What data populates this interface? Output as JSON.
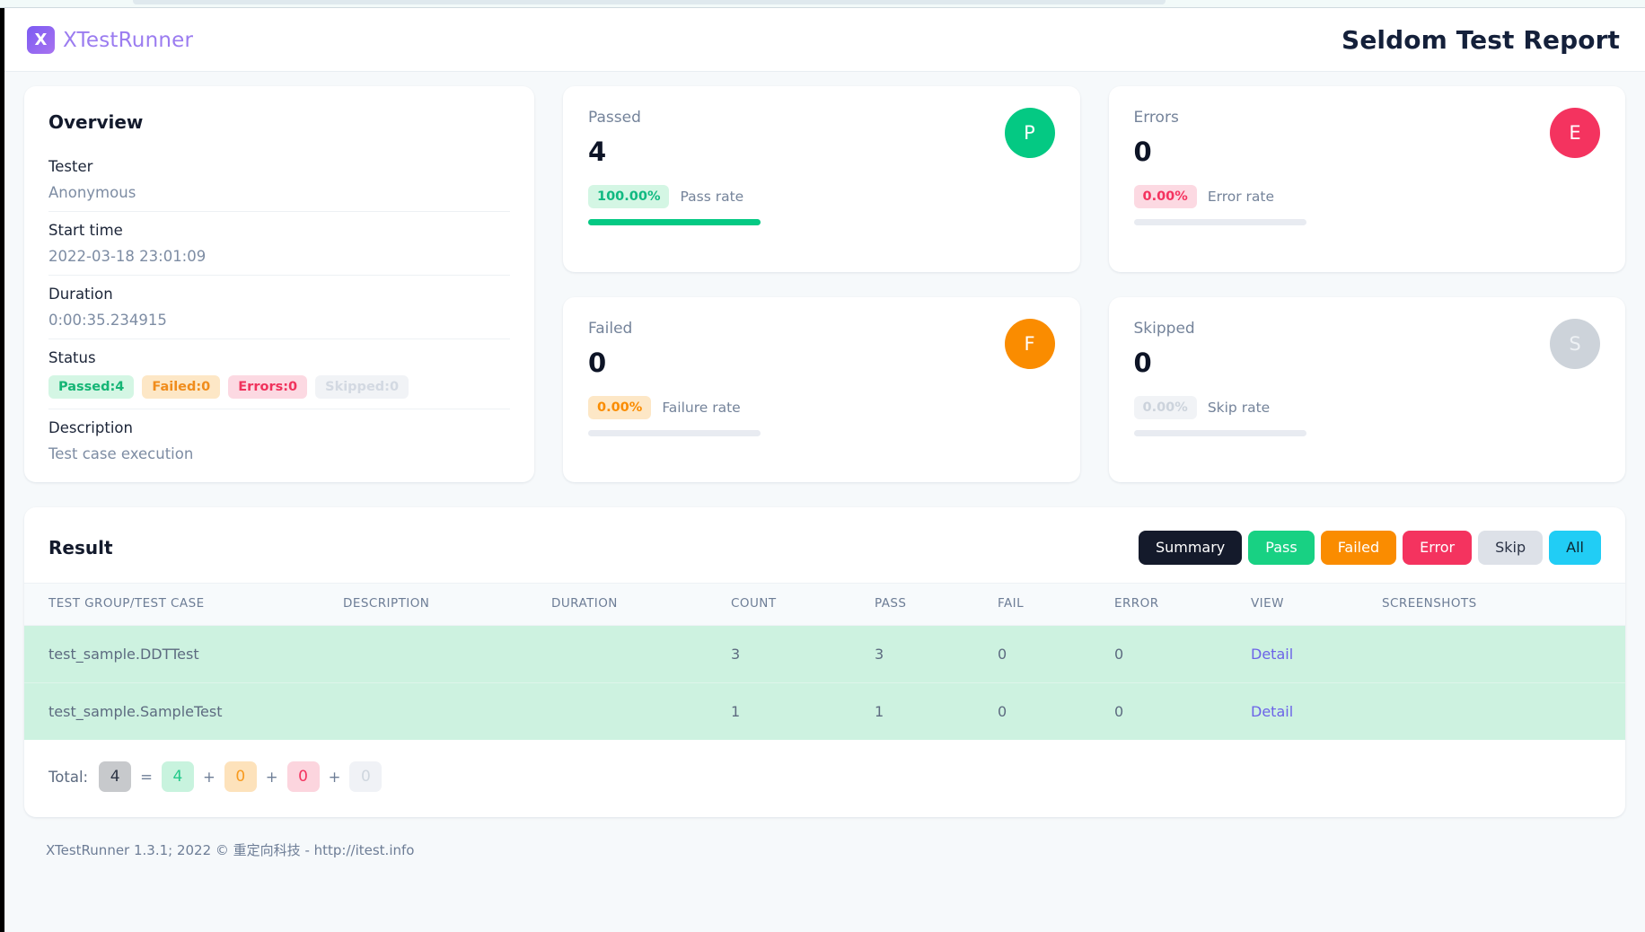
{
  "header": {
    "logo_letter": "X",
    "brand": "XTestRunner",
    "title": "Seldom Test Report"
  },
  "overview": {
    "heading": "Overview",
    "rows": [
      {
        "label": "Tester",
        "value": "Anonymous"
      },
      {
        "label": "Start time",
        "value": "2022-03-18 23:01:09"
      },
      {
        "label": "Duration",
        "value": "0:00:35.234915"
      }
    ],
    "status_label": "Status",
    "status_badges": [
      {
        "text": "Passed:4",
        "color": "#15b575"
      },
      {
        "text": "Failed:0",
        "color": "#f08c1c"
      },
      {
        "text": "Errors:0",
        "color": "#f0325c"
      },
      {
        "text": "Skipped:0",
        "color": "#d3d9e2"
      }
    ],
    "description_label": "Description",
    "description_value": "Test case execution"
  },
  "stats": {
    "passed": {
      "title": "Passed",
      "count": "4",
      "rate": "100.00%",
      "rate_label": "Pass rate",
      "badge": "P",
      "color": "#04c983",
      "bar_pct": 100
    },
    "errors": {
      "title": "Errors",
      "count": "0",
      "rate": "0.00%",
      "rate_label": "Error rate",
      "badge": "E",
      "color": "#f4335f",
      "bar_pct": 0
    },
    "failed": {
      "title": "Failed",
      "count": "0",
      "rate": "0.00%",
      "rate_label": "Failure rate",
      "badge": "F",
      "color": "#fa8c00",
      "bar_pct": 0
    },
    "skipped": {
      "title": "Skipped",
      "count": "0",
      "rate": "0.00%",
      "rate_label": "Skip rate",
      "badge": "S",
      "color": "#cdd3da",
      "bar_pct": 0
    }
  },
  "result": {
    "heading": "Result",
    "filters": [
      {
        "label": "Summary",
        "bg": "#141a2b",
        "fg": "#ffffff"
      },
      {
        "label": "Pass",
        "bg": "#18d183",
        "fg": "#ffffff"
      },
      {
        "label": "Failed",
        "bg": "#fa8c00",
        "fg": "#ffffff"
      },
      {
        "label": "Error",
        "bg": "#f4335f",
        "fg": "#ffffff"
      },
      {
        "label": "Skip",
        "bg": "#dde1e8",
        "fg": "#2a3245"
      },
      {
        "label": "All",
        "bg": "#21cdf5",
        "fg": "#0d2630"
      }
    ],
    "columns": [
      "TEST GROUP/TEST CASE",
      "DESCRIPTION",
      "DURATION",
      "COUNT",
      "PASS",
      "FAIL",
      "ERROR",
      "VIEW",
      "SCREENSHOTS"
    ],
    "rows": [
      {
        "name": "test_sample.DDTTest",
        "description": "",
        "duration": "",
        "count": "3",
        "pass": "3",
        "fail": "0",
        "error": "0",
        "view": "Detail",
        "screenshots": ""
      },
      {
        "name": "test_sample.SampleTest",
        "description": "",
        "duration": "",
        "count": "1",
        "pass": "1",
        "fail": "0",
        "error": "0",
        "view": "Detail",
        "screenshots": ""
      }
    ],
    "total": {
      "label": "Total:",
      "total": "4",
      "equals": "=",
      "plus": "+",
      "pass": "4",
      "fail": "0",
      "error": "0",
      "skip": "0"
    }
  },
  "footer": {
    "text": "XTestRunner 1.3.1; 2022 © 重定向科技 - http://itest.info"
  }
}
